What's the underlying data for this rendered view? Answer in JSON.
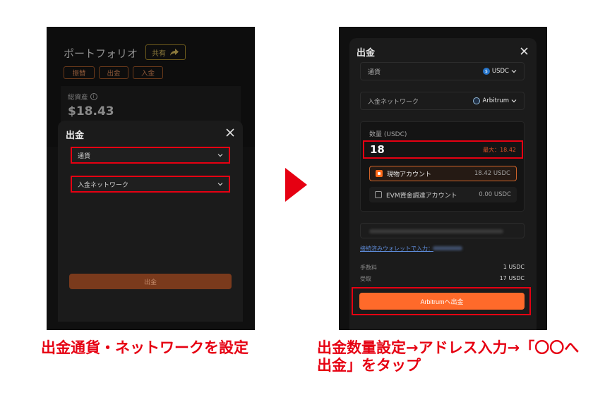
{
  "left_screen": {
    "portfolio": {
      "title": "ポートフォリオ",
      "share_label": "共有",
      "buttons": [
        "振替",
        "出金",
        "入金"
      ],
      "total_assets_label": "総資産",
      "total_assets_value": "$18.43"
    },
    "modal": {
      "title": "出金",
      "currency_field": "通貨",
      "network_field": "入金ネットワーク",
      "submit_label": "出金"
    }
  },
  "right_screen": {
    "modal": {
      "title": "出金",
      "currency_label": "通貨",
      "currency_value": "USDC",
      "network_label": "入金ネットワーク",
      "network_value": "Arbitrum",
      "amount_label": "数量 (USDC)",
      "amount_value": "18",
      "max_label": "最大：18.42",
      "accounts": [
        {
          "name": "現物アカウント",
          "amount": "18.42 USDC",
          "selected": true
        },
        {
          "name": "EVM資金調達アカウント",
          "amount": "0.00 USDC",
          "selected": false
        }
      ],
      "connected_wallet_link": "接続済みウォレットで入力：",
      "fee_label": "手数料",
      "fee_value": "1 USDC",
      "receive_label": "受取",
      "receive_value": "17 USDC",
      "submit_label": "Arbitrumへ出金"
    }
  },
  "captions": {
    "left": "出金通貨・ネットワークを設定",
    "right": "出金数量設定→アドレス入力→「〇〇へ出金」をタップ"
  },
  "colors": {
    "highlight_red": "#e60012",
    "accent_orange": "#ff6a2a",
    "panel_bg": "#101010",
    "modal_bg": "#1b1b1b"
  }
}
